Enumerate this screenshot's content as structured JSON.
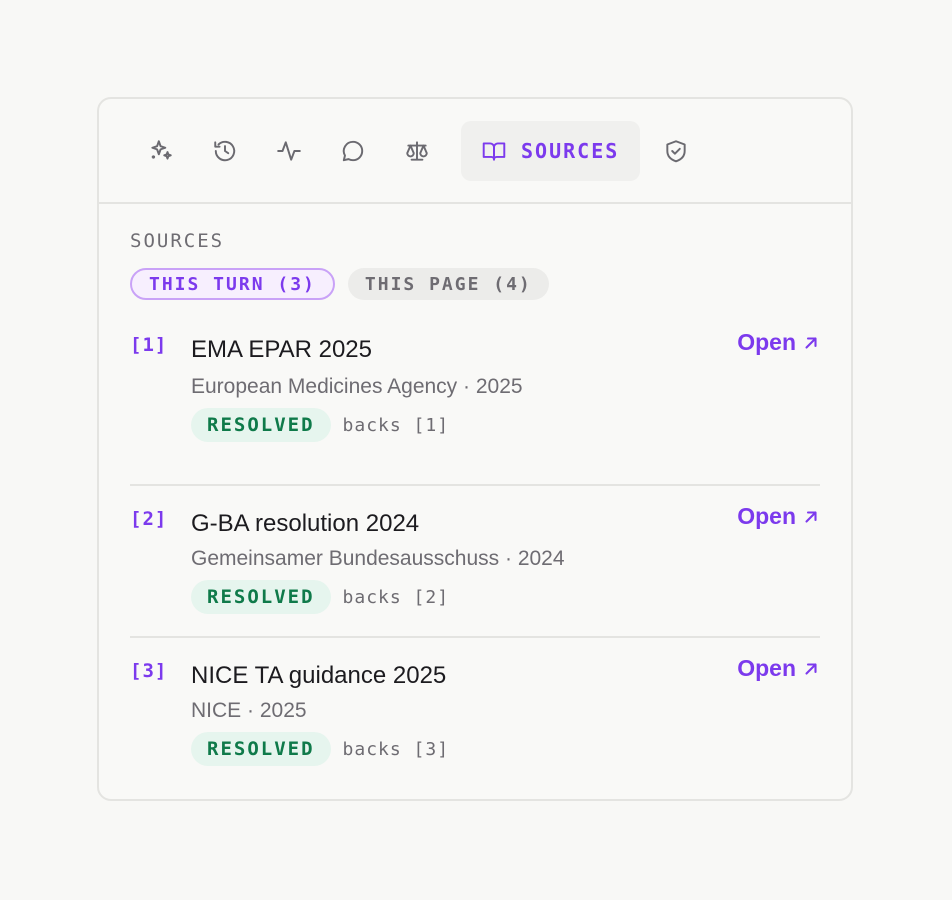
{
  "toolbar": {
    "tools": [
      {
        "icon": "sparkles-icon"
      },
      {
        "icon": "history-icon"
      },
      {
        "icon": "activity-icon"
      },
      {
        "icon": "chat-icon"
      },
      {
        "icon": "scale-icon"
      },
      {
        "icon": "book-icon",
        "label": "SOURCES",
        "active": true
      },
      {
        "icon": "shield-check-icon"
      }
    ]
  },
  "panel": {
    "section_title": "SOURCES",
    "filters": [
      {
        "label": "THIS TURN (3)",
        "selected": true
      },
      {
        "label": "THIS PAGE (4)",
        "selected": false
      }
    ],
    "sources": [
      {
        "ref": "[1]",
        "title": "EMA EPAR 2025",
        "meta": "European Medicines Agency · 2025",
        "status": "RESOLVED",
        "backs": "backs [1]",
        "open_label": "Open"
      },
      {
        "ref": "[2]",
        "title": "G-BA resolution 2024",
        "meta": "Gemeinsamer Bundesausschuss · 2024",
        "status": "RESOLVED",
        "backs": "backs [2]",
        "open_label": "Open"
      },
      {
        "ref": "[3]",
        "title": "NICE TA guidance 2025",
        "meta": "NICE · 2025",
        "status": "RESOLVED",
        "backs": "backs [3]",
        "open_label": "Open"
      }
    ]
  },
  "colors": {
    "accent": "#7c3aed",
    "resolved_bg": "#e6f5ee",
    "resolved_text": "#0f7a4a",
    "muted": "#6e6c72"
  }
}
